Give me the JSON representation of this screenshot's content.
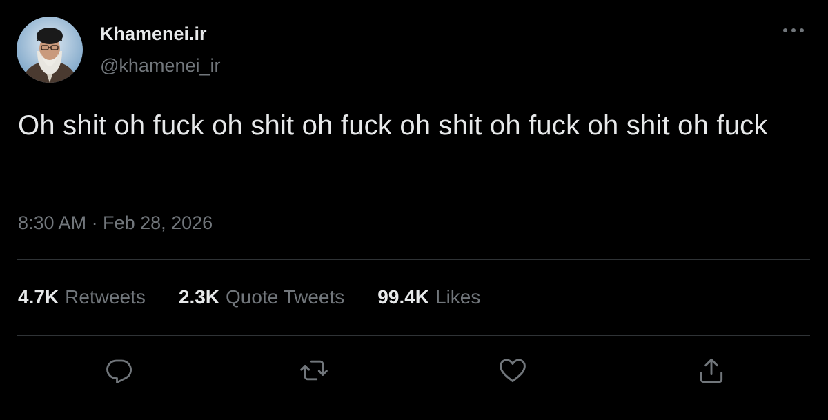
{
  "author": {
    "display_name": "Khamenei.ir",
    "handle": "@khamenei_ir"
  },
  "tweet": {
    "text": "Oh shit oh fuck oh shit oh fuck oh shit oh fuck oh shit oh fuck",
    "timestamp": "8:30 AM · Feb 28, 2026"
  },
  "stats": {
    "retweets": {
      "count": "4.7K",
      "label": "Retweets"
    },
    "quotes": {
      "count": "2.3K",
      "label": "Quote Tweets"
    },
    "likes": {
      "count": "99.4K",
      "label": "Likes"
    }
  },
  "actions": [
    {
      "icon": "reply-icon"
    },
    {
      "icon": "retweet-icon"
    },
    {
      "icon": "like-icon"
    },
    {
      "icon": "share-icon"
    }
  ],
  "colors": {
    "background": "#000000",
    "primary_text": "#e7e9ea",
    "secondary_text": "#71767b",
    "divider": "#2f3336"
  }
}
